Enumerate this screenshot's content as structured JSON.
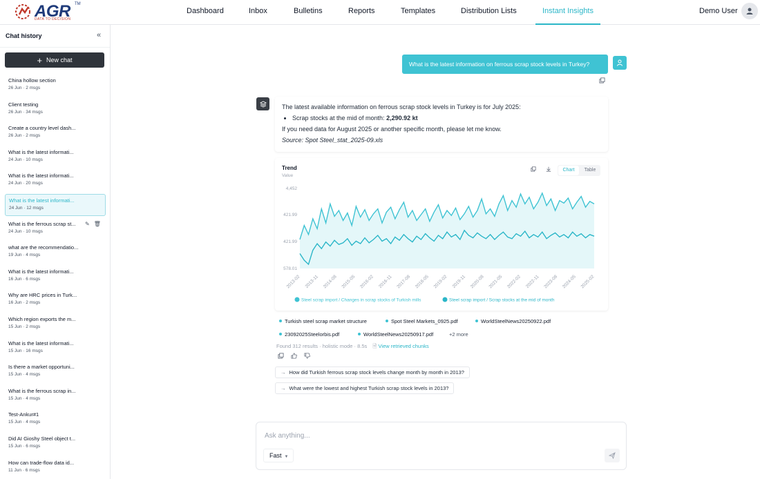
{
  "brand": {
    "name": "AGR",
    "trademark": "TM",
    "tagline": "DATA TO DECISION"
  },
  "nav": {
    "items": [
      {
        "label": "Dashboard"
      },
      {
        "label": "Inbox"
      },
      {
        "label": "Bulletins"
      },
      {
        "label": "Reports"
      },
      {
        "label": "Templates"
      },
      {
        "label": "Distribution Lists"
      },
      {
        "label": "Instant Insights"
      }
    ],
    "active": "Instant Insights",
    "user_name": "Demo User"
  },
  "sidebar": {
    "title": "Chat history",
    "new_chat_label": "New chat",
    "items": [
      {
        "title": "China hollow section",
        "meta": "26 Jun · 2 msgs"
      },
      {
        "title": "Client testing",
        "meta": "26 Jun · 34 msgs"
      },
      {
        "title": "Create a country level dash...",
        "meta": "26 Jun · 2 msgs"
      },
      {
        "title": "What is the latest informati...",
        "meta": "24 Jun · 10 msgs"
      },
      {
        "title": "What is the latest informati...",
        "meta": "24 Jun · 20 msgs"
      },
      {
        "title": "What is the latest informati...",
        "meta": "24 Jun · 12 msgs"
      },
      {
        "title": "What is the ferrous scrap st...",
        "meta": "24 Jun · 10 msgs"
      },
      {
        "title": "what are the recommendatio...",
        "meta": "19 Jun · 4 msgs"
      },
      {
        "title": "What is the latest informati...",
        "meta": "16 Jun · 6 msgs"
      },
      {
        "title": "Why are HRC prices in Turk...",
        "meta": "16 Jun · 2 msgs"
      },
      {
        "title": "Which region exports the m...",
        "meta": "15 Jun · 2 msgs"
      },
      {
        "title": "What is the latest informati...",
        "meta": "15 Jun · 16 msgs"
      },
      {
        "title": "Is there a market opportuni...",
        "meta": "15 Jun · 4 msgs"
      },
      {
        "title": "What is the ferrous scrap in...",
        "meta": "15 Jun · 4 msgs"
      },
      {
        "title": "Test-Ankur#1",
        "meta": "15 Jun · 4 msgs"
      },
      {
        "title": "Did AI Gioshy Steel object t...",
        "meta": "15 Jun · 6 msgs"
      },
      {
        "title": "How can trade-flow data id...",
        "meta": "11 Jun · 6 msgs"
      }
    ],
    "selected_index": 5,
    "hover_index": 6
  },
  "conversation": {
    "user_message": "What is the latest information on ferrous scrap stock levels in Turkey?",
    "answer": {
      "intro": "The latest available information on ferrous scrap stock levels in Turkey is for July 2025:",
      "bullet_label": "Scrap stocks at the mid of month: ",
      "bullet_value": "2,290.92 kt",
      "followup_text": "If you need data for August 2025 or another specific month, please let me know.",
      "source": "Source: Spot Steel_stat_2025-09.xls"
    },
    "sources": [
      "Turkish steel scrap market structure",
      "Spot Steel Markets_0925.pdf",
      "WorldSteelNews20250922.pdf",
      "23092025Steelorbis.pdf",
      "WorldSteelNews20250917.pdf"
    ],
    "more_sources": "+2 more",
    "result_meta": "Found 312 results · holistic mode · 8.5s",
    "view_chunks": "View retrieved chunks",
    "followups": [
      "How did Turkish ferrous scrap stock levels change month by month in 2013?",
      "What were the lowest and highest Turkish scrap stock levels in 2013?"
    ]
  },
  "chart_data": {
    "type": "area",
    "title": "Trend",
    "ylabel": "Value",
    "y_tick_labels": [
      "4,452",
      "421.99",
      "421.99",
      "578.01"
    ],
    "x_tick_labels": [
      "2013-02",
      "2013-11",
      "2014-08",
      "2015-05",
      "2016-02",
      "2016-11",
      "2017-08",
      "2018-05",
      "2019-02",
      "2019-11",
      "2020-08",
      "2021-05",
      "2022-02",
      "2022-11",
      "2023-08",
      "2024-05",
      "2025-02"
    ],
    "tabs": [
      "Chart",
      "Table"
    ],
    "active_tab": "Chart",
    "series": [
      {
        "name": "Steel scrap import / Changes in scrap stocks of Turkish mills",
        "color": "#3fc3d3",
        "fill": true,
        "values": [
          0.35,
          0.52,
          0.41,
          0.6,
          0.48,
          0.72,
          0.55,
          0.78,
          0.63,
          0.7,
          0.58,
          0.67,
          0.52,
          0.75,
          0.62,
          0.71,
          0.58,
          0.66,
          0.72,
          0.55,
          0.68,
          0.74,
          0.6,
          0.71,
          0.8,
          0.62,
          0.7,
          0.58,
          0.65,
          0.72,
          0.57,
          0.68,
          0.77,
          0.61,
          0.7,
          0.64,
          0.73,
          0.59,
          0.66,
          0.75,
          0.62,
          0.7,
          0.84,
          0.66,
          0.72,
          0.63,
          0.78,
          0.88,
          0.7,
          0.82,
          0.74,
          0.9,
          0.78,
          0.86,
          0.72,
          0.8,
          0.91,
          0.76,
          0.84,
          0.7,
          0.82,
          0.79,
          0.85,
          0.72,
          0.8,
          0.87,
          0.74,
          0.81,
          0.78
        ]
      },
      {
        "name": "Steel scrap import / Scrap stocks at the mid of month",
        "color": "#2bb6c8",
        "fill": false,
        "values": [
          0.18,
          0.1,
          0.05,
          0.22,
          0.3,
          0.24,
          0.32,
          0.27,
          0.34,
          0.29,
          0.31,
          0.36,
          0.28,
          0.33,
          0.3,
          0.37,
          0.31,
          0.35,
          0.4,
          0.33,
          0.36,
          0.3,
          0.38,
          0.34,
          0.41,
          0.36,
          0.32,
          0.39,
          0.35,
          0.42,
          0.37,
          0.33,
          0.4,
          0.36,
          0.44,
          0.38,
          0.41,
          0.35,
          0.46,
          0.4,
          0.37,
          0.43,
          0.39,
          0.36,
          0.41,
          0.35,
          0.4,
          0.44,
          0.38,
          0.36,
          0.42,
          0.39,
          0.45,
          0.37,
          0.41,
          0.38,
          0.44,
          0.36,
          0.4,
          0.43,
          0.38,
          0.41,
          0.37,
          0.44,
          0.39,
          0.42,
          0.37,
          0.41,
          0.39
        ]
      }
    ],
    "legend_position": "bottom",
    "grid": false
  },
  "composer": {
    "placeholder": "Ask anything...",
    "mode": "Fast"
  },
  "colors": {
    "accent": "#3fc3d3",
    "active_nav": "#2bb6c8",
    "dark_button": "#2f343b"
  }
}
